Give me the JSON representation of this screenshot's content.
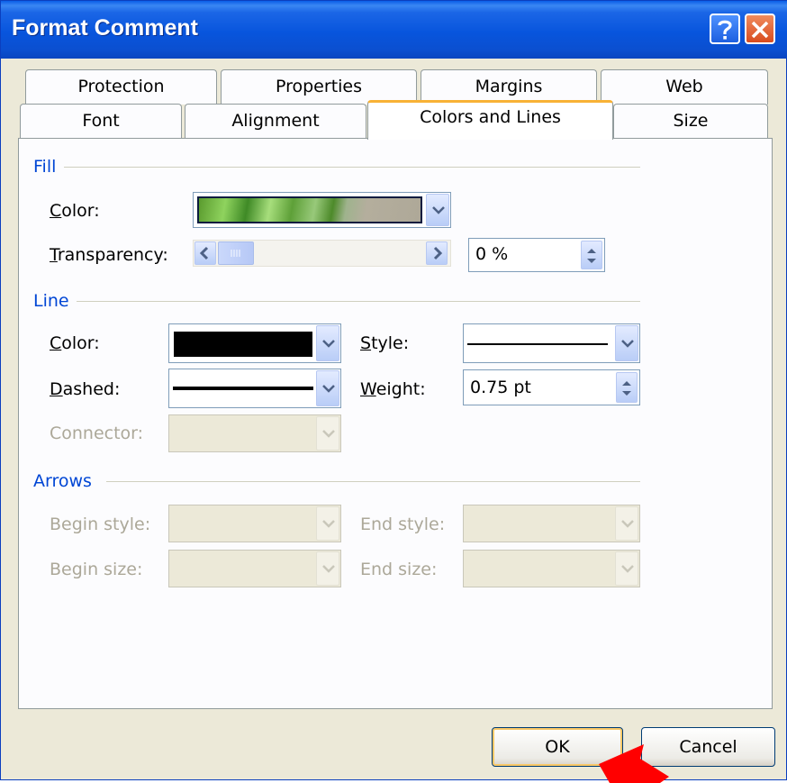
{
  "window": {
    "title": "Format Comment"
  },
  "tabs": {
    "row1": [
      "Protection",
      "Properties",
      "Margins",
      "Web"
    ],
    "row2": [
      "Font",
      "Alignment",
      "Colors and Lines",
      "Size"
    ],
    "active": "Colors and Lines"
  },
  "fill": {
    "group_label": "Fill",
    "color_label": "Color:",
    "transparency_label": "Transparency:",
    "transparency_value": "0 %",
    "transparency_level": 0
  },
  "line": {
    "group_label": "Line",
    "color_label": "Color:",
    "color_value": "#000000",
    "style_label": "Style:",
    "dashed_label": "Dashed:",
    "weight_label": "Weight:",
    "weight_value": "0.75 pt",
    "connector_label": "Connector:"
  },
  "arrows": {
    "group_label": "Arrows",
    "begin_style_label": "Begin style:",
    "end_style_label": "End style:",
    "begin_size_label": "Begin size:",
    "end_size_label": "End size:"
  },
  "buttons": {
    "ok": "OK",
    "cancel": "Cancel"
  },
  "colors": {
    "accent_blue": "#0046d5",
    "active_tab": "#f8b236",
    "annotation_arrow": "#ff0000"
  }
}
